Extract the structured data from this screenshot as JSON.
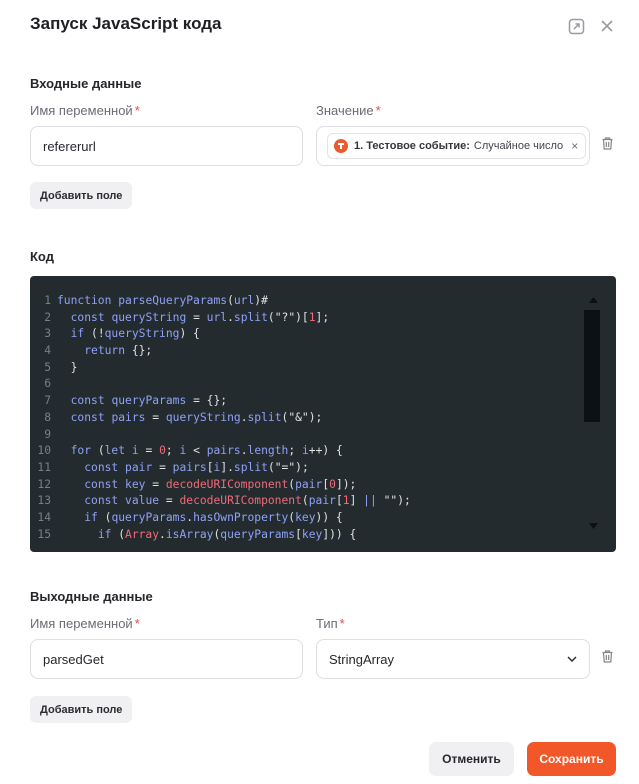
{
  "dialog": {
    "title": "Запуск JavaScript кода"
  },
  "input_section": {
    "title": "Входные данные",
    "var_label": "Имя переменной",
    "value_label": "Значение",
    "required_mark": "*",
    "var_value": "refererurl",
    "chip": {
      "event_name": "1. Тестовое событие:",
      "event_value": "Случайное число",
      "remove": "×"
    },
    "add_field": "Добавить поле"
  },
  "code_section": {
    "title": "Код",
    "lines": [
      {
        "n": "1",
        "tokens": [
          [
            "function",
            "#8fa1f5"
          ],
          [
            " ",
            "#e0e2e4"
          ],
          [
            "parseQueryParams",
            "#8fa1f5"
          ],
          [
            "(",
            "#e0e2e4"
          ],
          [
            "url",
            "#8fa1f5"
          ],
          ") {",
          "#e0e2e4"
        ]
      },
      {
        "n": "2",
        "tokens": [
          [
            "  ",
            "#e0e2e4"
          ],
          [
            "const",
            "#8fa1f5"
          ],
          [
            " ",
            "#e0e2e4"
          ],
          [
            "queryString",
            "#8fa1f5"
          ],
          [
            " = ",
            "#e0e2e4"
          ],
          [
            "url",
            "#8fa1f5"
          ],
          [
            ".",
            "#e0e2e4"
          ],
          [
            "split",
            "#8fa1f5"
          ],
          [
            "(",
            "#e0e2e4"
          ],
          [
            "\"?\"",
            "#e0e2e4"
          ],
          [
            ")[",
            "#e0e2e4"
          ],
          [
            "1",
            "#f06a78"
          ],
          [
            "];",
            "#e0e2e4"
          ]
        ]
      },
      {
        "n": "3",
        "tokens": [
          [
            "  ",
            "#e0e2e4"
          ],
          [
            "if",
            "#8fa1f5"
          ],
          [
            " (!",
            "#e0e2e4"
          ],
          [
            "queryString",
            "#8fa1f5"
          ],
          [
            ") {",
            "#e0e2e4"
          ]
        ]
      },
      {
        "n": "4",
        "tokens": [
          [
            "    ",
            "#e0e2e4"
          ],
          [
            "return",
            "#8fa1f5"
          ],
          [
            " {};",
            "#e0e2e4"
          ]
        ]
      },
      {
        "n": "5",
        "tokens": [
          [
            "  }",
            "#e0e2e4"
          ]
        ]
      },
      {
        "n": "6",
        "tokens": [
          [
            "",
            "#e0e2e4"
          ]
        ]
      },
      {
        "n": "7",
        "tokens": [
          [
            "  ",
            "#e0e2e4"
          ],
          [
            "const",
            "#8fa1f5"
          ],
          [
            " ",
            "#e0e2e4"
          ],
          [
            "queryParams",
            "#8fa1f5"
          ],
          [
            " = {};",
            "#e0e2e4"
          ]
        ]
      },
      {
        "n": "8",
        "tokens": [
          [
            "  ",
            "#e0e2e4"
          ],
          [
            "const",
            "#8fa1f5"
          ],
          [
            " ",
            "#e0e2e4"
          ],
          [
            "pairs",
            "#8fa1f5"
          ],
          [
            " = ",
            "#e0e2e4"
          ],
          [
            "queryString",
            "#8fa1f5"
          ],
          [
            ".",
            "#e0e2e4"
          ],
          [
            "split",
            "#8fa1f5"
          ],
          [
            "(",
            "#e0e2e4"
          ],
          [
            "\"&\"",
            "#e0e2e4"
          ],
          [
            ");",
            "#e0e2e4"
          ]
        ]
      },
      {
        "n": "9",
        "tokens": [
          [
            "",
            "#e0e2e4"
          ]
        ]
      },
      {
        "n": "10",
        "tokens": [
          [
            "  ",
            "#e0e2e4"
          ],
          [
            "for",
            "#8fa1f5"
          ],
          [
            " (",
            "#e0e2e4"
          ],
          [
            "let",
            "#8fa1f5"
          ],
          [
            " ",
            "#e0e2e4"
          ],
          [
            "i",
            "#8fa1f5"
          ],
          [
            " = ",
            "#e0e2e4"
          ],
          [
            "0",
            "#f06a78"
          ],
          [
            "; ",
            "#e0e2e4"
          ],
          [
            "i",
            "#8fa1f5"
          ],
          [
            " < ",
            "#e0e2e4"
          ],
          [
            "pairs",
            "#8fa1f5"
          ],
          [
            ".",
            "#e0e2e4"
          ],
          [
            "length",
            "#8fa1f5"
          ],
          [
            "; ",
            "#e0e2e4"
          ],
          [
            "i",
            "#8fa1f5"
          ],
          [
            "++) {",
            "#e0e2e4"
          ]
        ]
      },
      {
        "n": "11",
        "tokens": [
          [
            "    ",
            "#e0e2e4"
          ],
          [
            "const",
            "#8fa1f5"
          ],
          [
            " ",
            "#e0e2e4"
          ],
          [
            "pair",
            "#8fa1f5"
          ],
          [
            " = ",
            "#e0e2e4"
          ],
          [
            "pairs",
            "#8fa1f5"
          ],
          [
            "[",
            "#e0e2e4"
          ],
          [
            "i",
            "#8fa1f5"
          ],
          [
            "].",
            "#e0e2e4"
          ],
          [
            "split",
            "#8fa1f5"
          ],
          [
            "(",
            "#e0e2e4"
          ],
          [
            "\"=\"",
            "#e0e2e4"
          ],
          [
            ");",
            "#e0e2e4"
          ]
        ]
      },
      {
        "n": "12",
        "tokens": [
          [
            "    ",
            "#e0e2e4"
          ],
          [
            "const",
            "#8fa1f5"
          ],
          [
            " ",
            "#e0e2e4"
          ],
          [
            "key",
            "#8fa1f5"
          ],
          [
            " = ",
            "#e0e2e4"
          ],
          [
            "decodeURIComponent",
            "#f06a78"
          ],
          [
            "(",
            "#e0e2e4"
          ],
          [
            "pair",
            "#8fa1f5"
          ],
          [
            "[",
            "#e0e2e4"
          ],
          [
            "0",
            "#f06a78"
          ],
          [
            "]);",
            "#e0e2e4"
          ]
        ]
      },
      {
        "n": "13",
        "tokens": [
          [
            "    ",
            "#e0e2e4"
          ],
          [
            "const",
            "#8fa1f5"
          ],
          [
            " ",
            "#e0e2e4"
          ],
          [
            "value",
            "#8fa1f5"
          ],
          [
            " = ",
            "#e0e2e4"
          ],
          [
            "decodeURIComponent",
            "#f06a78"
          ],
          [
            "(",
            "#e0e2e4"
          ],
          [
            "pair",
            "#8fa1f5"
          ],
          [
            "[",
            "#e0e2e4"
          ],
          [
            "1",
            "#f06a78"
          ],
          [
            "] ",
            "#e0e2e4"
          ],
          [
            "||",
            "#8fa1f5"
          ],
          [
            " ",
            "#e0e2e4"
          ],
          [
            "\"\"",
            "#e0e2e4"
          ],
          [
            ");",
            "#e0e2e4"
          ]
        ]
      },
      {
        "n": "14",
        "tokens": [
          [
            "    ",
            "#e0e2e4"
          ],
          [
            "if",
            "#8fa1f5"
          ],
          [
            " (",
            "#e0e2e4"
          ],
          [
            "queryParams",
            "#8fa1f5"
          ],
          [
            ".",
            "#e0e2e4"
          ],
          [
            "hasOwnProperty",
            "#8fa1f5"
          ],
          [
            "(",
            "#e0e2e4"
          ],
          [
            "key",
            "#8fa1f5"
          ],
          [
            ")) {",
            "#e0e2e4"
          ]
        ]
      },
      {
        "n": "15",
        "tokens": [
          [
            "      ",
            "#e0e2e4"
          ],
          [
            "if",
            "#8fa1f5"
          ],
          [
            " (",
            "#e0e2e4"
          ],
          [
            "Array",
            "#f06a78"
          ],
          [
            ".",
            "#e0e2e4"
          ],
          [
            "isArray",
            "#8fa1f5"
          ],
          [
            "(",
            "#e0e2e4"
          ],
          [
            "queryParams",
            "#8fa1f5"
          ],
          [
            "[",
            "#e0e2e4"
          ],
          [
            "key",
            "#8fa1f5"
          ],
          [
            "])) {",
            "#e0e2e4"
          ]
        ]
      }
    ]
  },
  "output_section": {
    "title": "Выходные данные",
    "var_label": "Имя переменной",
    "type_label": "Тип",
    "required_mark": "*",
    "var_value": "parsedGet",
    "type_value": "StringArray",
    "add_field": "Добавить поле"
  },
  "footer": {
    "cancel": "Отменить",
    "save": "Сохранить"
  },
  "colors": {
    "accent": "#f2572a",
    "required": "#e8464b",
    "code_bg": "#232b2f"
  }
}
